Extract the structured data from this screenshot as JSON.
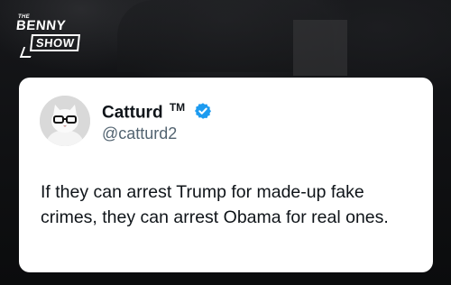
{
  "logo": {
    "the": "THE",
    "benny": "BENNY",
    "show": "SHOW"
  },
  "tweet": {
    "display_name": "Catturd",
    "trademark": "TM",
    "handle": "@catturd2",
    "verified": true,
    "verified_color": "#1d9bf0",
    "text": "If they can arrest Trump for made-up fake crimes, they can arrest Obama for real ones."
  }
}
